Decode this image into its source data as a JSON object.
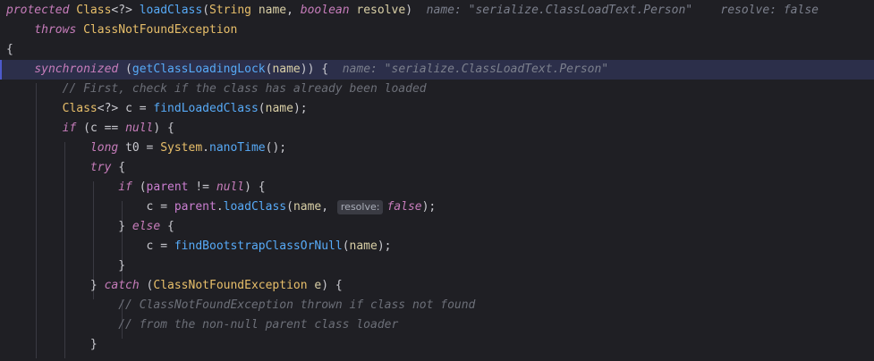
{
  "editor": {
    "lines": [
      {
        "id": "l1",
        "tokens": [
          [
            "kw",
            "protected"
          ],
          [
            "punc",
            " "
          ],
          [
            "type",
            "Class"
          ],
          [
            "punc",
            "<?> "
          ],
          [
            "fn",
            "loadClass"
          ],
          [
            "punc",
            "("
          ],
          [
            "type",
            "String"
          ],
          [
            "punc",
            " "
          ],
          [
            "param",
            "name"
          ],
          [
            "punc",
            ", "
          ],
          [
            "kw",
            "boolean"
          ],
          [
            "punc",
            " "
          ],
          [
            "param",
            "resolve"
          ],
          [
            "punc",
            ")"
          ]
        ],
        "hint": "name: \"serialize.ClassLoadText.Person\"    resolve: false"
      },
      {
        "id": "l2",
        "tokens": [
          [
            "punc",
            "    "
          ],
          [
            "kw",
            "throws"
          ],
          [
            "punc",
            " "
          ],
          [
            "type",
            "ClassNotFoundException"
          ]
        ]
      },
      {
        "id": "l3",
        "tokens": [
          [
            "punc",
            "{"
          ]
        ]
      },
      {
        "id": "l4",
        "tokens": [
          [
            "punc",
            "    "
          ],
          [
            "kw",
            "synchronized"
          ],
          [
            "punc",
            " ("
          ],
          [
            "fn",
            "getClassLoadingLock"
          ],
          [
            "punc",
            "("
          ],
          [
            "param",
            "name"
          ],
          [
            "punc",
            ")) {"
          ]
        ],
        "hint": "name: \"serialize.ClassLoadText.Person\""
      },
      {
        "id": "l5",
        "tokens": [
          [
            "cmt",
            "        // First, check if the class has already been loaded"
          ]
        ]
      },
      {
        "id": "l6",
        "tokens": [
          [
            "punc",
            "        "
          ],
          [
            "type",
            "Class"
          ],
          [
            "punc",
            "<?> "
          ],
          [
            "ident",
            "c"
          ],
          [
            "punc",
            " = "
          ],
          [
            "fn",
            "findLoadedClass"
          ],
          [
            "punc",
            "("
          ],
          [
            "param",
            "name"
          ],
          [
            "punc",
            ");"
          ]
        ]
      },
      {
        "id": "l7",
        "tokens": [
          [
            "punc",
            "        "
          ],
          [
            "kw",
            "if"
          ],
          [
            "punc",
            " ("
          ],
          [
            "ident",
            "c"
          ],
          [
            "punc",
            " == "
          ],
          [
            "kw",
            "null"
          ],
          [
            "punc",
            ") {"
          ]
        ]
      },
      {
        "id": "l8",
        "tokens": [
          [
            "punc",
            "            "
          ],
          [
            "kw",
            "long"
          ],
          [
            "punc",
            " "
          ],
          [
            "ident",
            "t0"
          ],
          [
            "punc",
            " = "
          ],
          [
            "type",
            "System"
          ],
          [
            "punc",
            "."
          ],
          [
            "fn",
            "nanoTime"
          ],
          [
            "punc",
            "();"
          ]
        ]
      },
      {
        "id": "l9",
        "tokens": [
          [
            "punc",
            "            "
          ],
          [
            "kw",
            "try"
          ],
          [
            "punc",
            " {"
          ]
        ]
      },
      {
        "id": "l10",
        "tokens": [
          [
            "punc",
            "                "
          ],
          [
            "kw",
            "if"
          ],
          [
            "punc",
            " ("
          ],
          [
            "field",
            "parent"
          ],
          [
            "punc",
            " != "
          ],
          [
            "kw",
            "null"
          ],
          [
            "punc",
            ") {"
          ]
        ]
      },
      {
        "id": "l11",
        "tokens": [
          [
            "punc",
            "                    "
          ],
          [
            "ident",
            "c"
          ],
          [
            "punc",
            " = "
          ],
          [
            "field",
            "parent"
          ],
          [
            "punc",
            "."
          ],
          [
            "fn",
            "loadClass"
          ],
          [
            "punc",
            "("
          ],
          [
            "param",
            "name"
          ],
          [
            "punc",
            ", "
          ]
        ],
        "inlay": "resolve:",
        "after": [
          [
            "bool-false",
            "false"
          ],
          [
            "punc",
            ");"
          ]
        ]
      },
      {
        "id": "l12",
        "tokens": [
          [
            "punc",
            "                "
          ],
          [
            "punc",
            "} "
          ],
          [
            "kw",
            "else"
          ],
          [
            "punc",
            " {"
          ]
        ]
      },
      {
        "id": "l13",
        "tokens": [
          [
            "punc",
            "                    "
          ],
          [
            "ident",
            "c"
          ],
          [
            "punc",
            " = "
          ],
          [
            "fn",
            "findBootstrapClassOrNull"
          ],
          [
            "punc",
            "("
          ],
          [
            "param",
            "name"
          ],
          [
            "punc",
            ");"
          ]
        ]
      },
      {
        "id": "l14",
        "tokens": [
          [
            "punc",
            "                }"
          ]
        ]
      },
      {
        "id": "l15",
        "tokens": [
          [
            "punc",
            "            } "
          ],
          [
            "kw",
            "catch"
          ],
          [
            "punc",
            " ("
          ],
          [
            "type",
            "ClassNotFoundException"
          ],
          [
            "punc",
            " "
          ],
          [
            "param",
            "e"
          ],
          [
            "punc",
            ") {"
          ]
        ]
      },
      {
        "id": "l16",
        "tokens": [
          [
            "cmt",
            "                // ClassNotFoundException thrown if class not found"
          ]
        ]
      },
      {
        "id": "l17",
        "tokens": [
          [
            "cmt",
            "                // from the non-null parent class loader"
          ]
        ]
      },
      {
        "id": "l18",
        "tokens": [
          [
            "punc",
            "            }"
          ]
        ]
      }
    ],
    "current_line": 3
  }
}
